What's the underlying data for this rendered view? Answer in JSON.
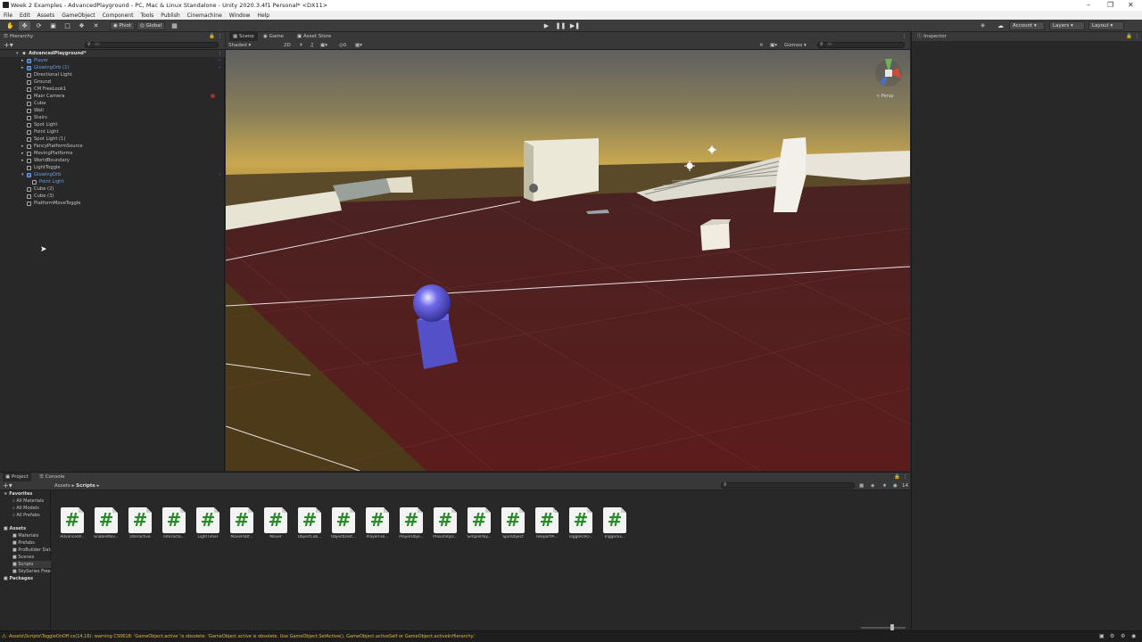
{
  "window": {
    "title": "Week 2 Examples - AdvancedPlayground - PC, Mac & Linux Standalone - Unity 2020.3.4f1 Personal* <DX11>"
  },
  "menu": [
    "File",
    "Edit",
    "Assets",
    "GameObject",
    "Component",
    "Tools",
    "Publish",
    "Cinemachine",
    "Window",
    "Help"
  ],
  "toolbar": {
    "pivot_label": "Pivot",
    "global_label": "Global",
    "account_label": "Account",
    "layers_label": "Layers",
    "layout_label": "Layout"
  },
  "hierarchy": {
    "tab_label": "Hierarchy",
    "search_placeholder": "All",
    "scene_name": "AdvancedPlayground*",
    "items": [
      {
        "label": "Player",
        "highlight": true,
        "prefab": true
      },
      {
        "label": "GlowingOrb (1)",
        "highlight": true,
        "prefab": true
      },
      {
        "label": "Directional Light"
      },
      {
        "label": "Ground"
      },
      {
        "label": "CM FreeLook1"
      },
      {
        "label": "Main Camera"
      },
      {
        "label": "Cube"
      },
      {
        "label": "Wall"
      },
      {
        "label": "Stairs"
      },
      {
        "label": "Spot Light"
      },
      {
        "label": "Point Light"
      },
      {
        "label": "Spot Light (1)"
      },
      {
        "label": "FancyPlatformSource"
      },
      {
        "label": "MovingPlatforms"
      },
      {
        "label": "WorldBoundary"
      },
      {
        "label": "LightToggle"
      },
      {
        "label": "GlowingOrb",
        "highlight": true,
        "prefab": true
      },
      {
        "label": "Point Light",
        "highlight": true,
        "child": true
      },
      {
        "label": "Cube (2)"
      },
      {
        "label": "Cube (3)"
      },
      {
        "label": "PlatformMoveToggle"
      }
    ]
  },
  "scene_view": {
    "tabs": [
      "Scene",
      "Game",
      "Asset Store"
    ],
    "shading_mode": "Shaded",
    "mode_2d": "2D",
    "gizmos_label": "Gizmos",
    "search_placeholder": "All",
    "orientation_label": "< Persp"
  },
  "inspector": {
    "tab_label": "Inspector"
  },
  "project": {
    "tabs": [
      "Project",
      "Console"
    ],
    "breadcrumb": [
      "Assets",
      "Scripts"
    ],
    "count_badge": "14",
    "favorites": {
      "label": "Favorites",
      "items": [
        "All Materials",
        "All Models",
        "All Prefabs"
      ]
    },
    "assets": {
      "label": "Assets",
      "items": [
        "Materials",
        "Prefabs",
        "ProBuilder Data",
        "Scenes",
        "Scripts",
        "SkySeries Freebie"
      ]
    },
    "packages_label": "Packages",
    "scripts": [
      "AdvancedP...",
      "EnableMov...",
      "Interactive",
      "Interacta...",
      "LightTimer",
      "MovePlatf...",
      "Mover",
      "ObjectCob...",
      "ObjectDest...",
      "PlayerFall...",
      "PlayerObje...",
      "ProximityD...",
      "SimplePlay...",
      "SpinObject",
      "TeleportPl...",
      "ToggleOnO...",
      "TriggerEx..."
    ]
  },
  "status": {
    "warning": "Assets\\Scripts\\ToggleOnOff.cs(14,16): warning CS0618: 'GameObject.active' is obsolete: 'GameObject.active is obsolete. Use GameObject.SetActive(), GameObject.activeSelf or GameObject.activeInHierarchy.'"
  },
  "colors": {
    "accent_blue": "#6c9fe3",
    "warning_yellow": "#e0b84d",
    "script_icon_green": "#2a8a2a",
    "ground_red": "#6b2424",
    "player_purple": "#5a50d0"
  }
}
